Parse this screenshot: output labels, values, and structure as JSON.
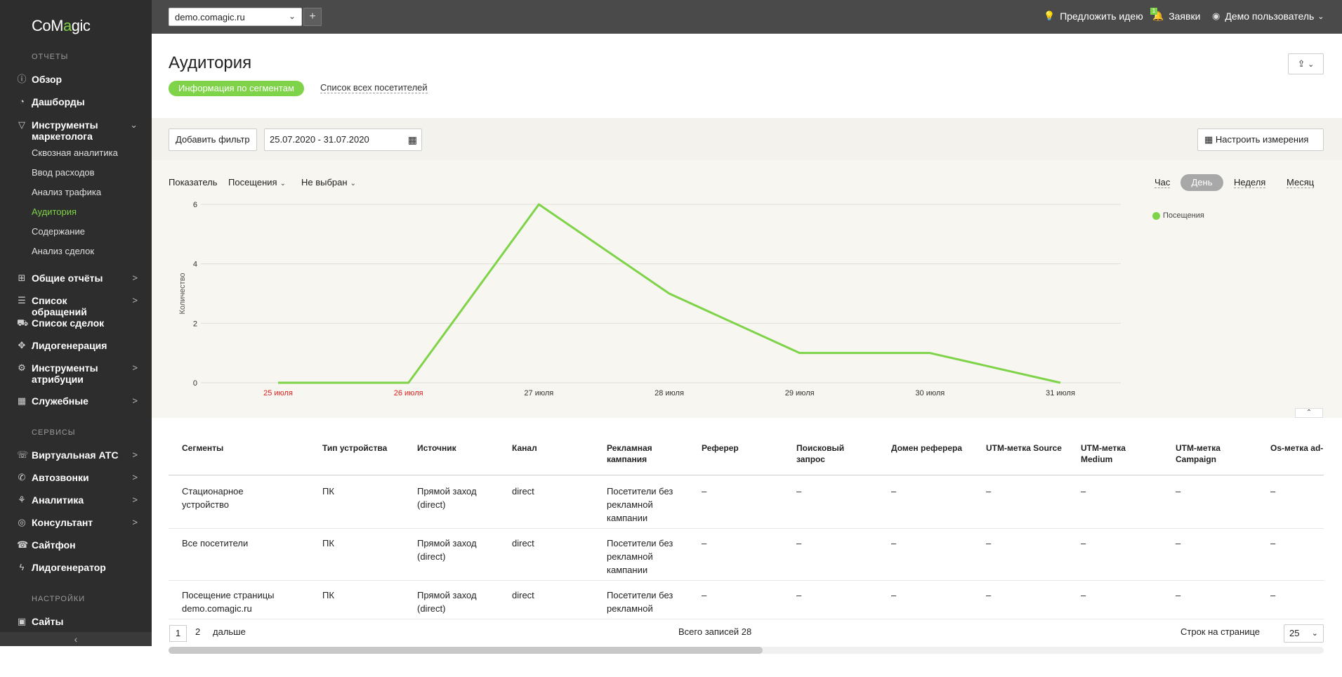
{
  "sidebar": {
    "logo": {
      "co": "Co",
      "m": "M",
      "o": "a",
      "rest": "gic"
    },
    "sections": {
      "reports": "ОТЧЕТЫ",
      "services": "СЕРВИСЫ",
      "settings": "НАСТРОЙКИ"
    },
    "items": {
      "overview": "Обзор",
      "dashboards": "Дашборды",
      "marketing": "Инструменты маркетолога",
      "general": "Общие отчёты",
      "requests": "Список обращений",
      "deals": "Список сделок",
      "leadgen": "Лидогенерация",
      "attribution": "Инструменты атрибуции",
      "service": "Служебные",
      "pbx": "Виртуальная АТС",
      "autocalls": "Автозвонки",
      "analytics": "Аналитика",
      "consultant": "Консультант",
      "sitephone": "Сайтфон",
      "leadgenerator": "Лидогенератор",
      "sites": "Сайты"
    },
    "sub": {
      "e2e": "Сквозная аналитика",
      "costs": "Ввод расходов",
      "traffic": "Анализ трафика",
      "audience": "Аудитория",
      "content": "Содержание",
      "deals_analysis": "Анализ сделок"
    }
  },
  "topbar": {
    "site": "demo.comagic.ru",
    "idea": "Предложить идею",
    "requests": "Заявки",
    "requests_count": "1",
    "user": "Демо пользователь"
  },
  "page": {
    "title": "Аудитория",
    "tab_active": "Информация по сегментам",
    "tab_other": "Список всех посетителей"
  },
  "filters": {
    "add_filter": "Добавить фильтр",
    "date_range": "25.07.2020 - 31.07.2020",
    "configure": "Настроить измерения"
  },
  "controls": {
    "metric_label": "Показатель",
    "metric_value": "Посещения",
    "second_value": "Не выбран",
    "periods": [
      "Час",
      "День",
      "Неделя",
      "Месяц"
    ],
    "period_active": "День"
  },
  "chart_data": {
    "type": "line",
    "x": [
      "25 июля",
      "26 июля",
      "27 июля",
      "28 июля",
      "29 июля",
      "30 июля",
      "31 июля"
    ],
    "weekend_x": [
      "25 июля",
      "26 июля"
    ],
    "series": [
      {
        "name": "Посещения",
        "values": [
          0,
          0,
          6,
          3,
          1,
          1,
          0
        ],
        "color": "#7ed348"
      }
    ],
    "ylabel": "Количество",
    "yticks": [
      0,
      2,
      4,
      6
    ],
    "ylim": [
      0,
      6
    ],
    "grid": true,
    "legend": "right"
  },
  "table": {
    "headers": [
      "Сегменты",
      "Тип устройства",
      "Источник",
      "Канал",
      "Рекламная кампания",
      "Реферер",
      "Поисковый запрос",
      "Домен реферера",
      "UTM-метка Source",
      "UTM-метка Medium",
      "UTM-метка Campaign",
      "Os-метка ad-"
    ],
    "rows": [
      [
        "Стационарное устройство",
        "ПК",
        "Прямой заход (direct)",
        "direct",
        "Посетители без рекламной кампании",
        "–",
        "–",
        "–",
        "–",
        "–",
        "–",
        "–"
      ],
      [
        "Все посетители",
        "ПК",
        "Прямой заход (direct)",
        "direct",
        "Посетители без рекламной кампании",
        "–",
        "–",
        "–",
        "–",
        "–",
        "–",
        "–"
      ],
      [
        "Посещение страницы demo.comagic.ru",
        "ПК",
        "Прямой заход (direct)",
        "direct",
        "Посетители без рекламной",
        "–",
        "–",
        "–",
        "–",
        "–",
        "–",
        "–"
      ]
    ]
  },
  "pagination": {
    "page1": "1",
    "page2": "2",
    "next": "дальше",
    "total": "Всего записей 28",
    "rows_label": "Строк на странице",
    "rows_value": "25"
  }
}
